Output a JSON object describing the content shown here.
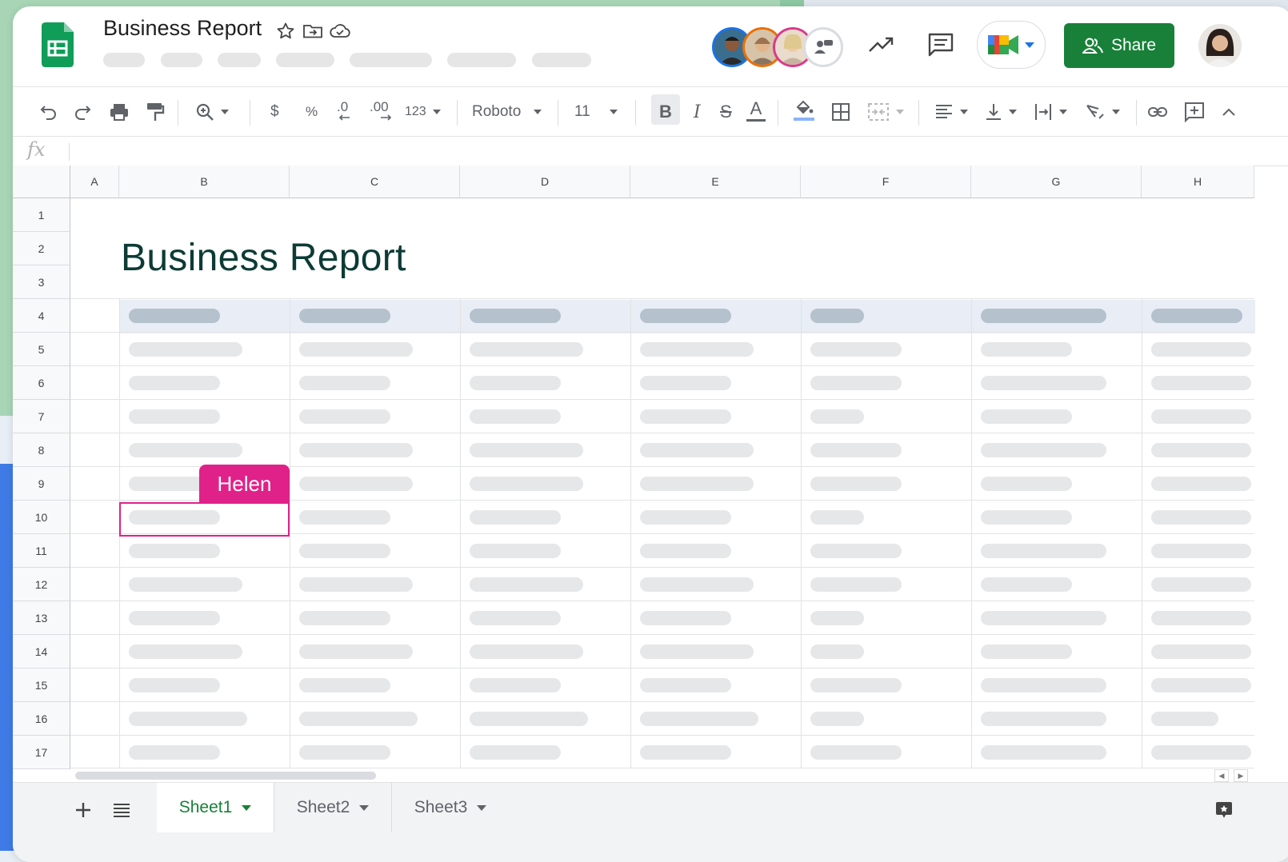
{
  "document": {
    "title": "Business Report"
  },
  "colors": {
    "brand_green": "#188038",
    "collaborator_pink": "#e0218a",
    "header_band": "#e8edf6",
    "title_color": "#0d3b36"
  },
  "header": {
    "share_label": "Share",
    "avatars": [
      "collaborator-avatar-1",
      "collaborator-avatar-2",
      "collaborator-avatar-3",
      "collaborator-avatar-more"
    ],
    "icons": [
      "activity-trend-icon",
      "comments-icon",
      "meet-icon",
      "user-avatar"
    ]
  },
  "toolbar": {
    "currency": "$",
    "percent": "%",
    "decimal_decrease": ".0",
    "decimal_increase": ".00",
    "number_format": "123",
    "font": "Roboto",
    "font_size": "11",
    "bold": "B",
    "italic": "I",
    "strikethrough": "S",
    "text_color": "A"
  },
  "formula_bar": {
    "fx": "fx",
    "value": ""
  },
  "grid": {
    "columns": [
      "A",
      "B",
      "C",
      "D",
      "E",
      "F",
      "G",
      "H"
    ],
    "rows": [
      "1",
      "2",
      "3",
      "4",
      "5",
      "6",
      "7",
      "8",
      "9",
      "10",
      "11",
      "12",
      "13",
      "14",
      "15",
      "16",
      "17"
    ],
    "report_title": "Business Report",
    "collaborator_cursor": {
      "name": "Helen",
      "cell": "B10"
    }
  },
  "sheets": [
    {
      "label": "Sheet1",
      "active": true
    },
    {
      "label": "Sheet2",
      "active": false
    },
    {
      "label": "Sheet3",
      "active": false
    }
  ]
}
